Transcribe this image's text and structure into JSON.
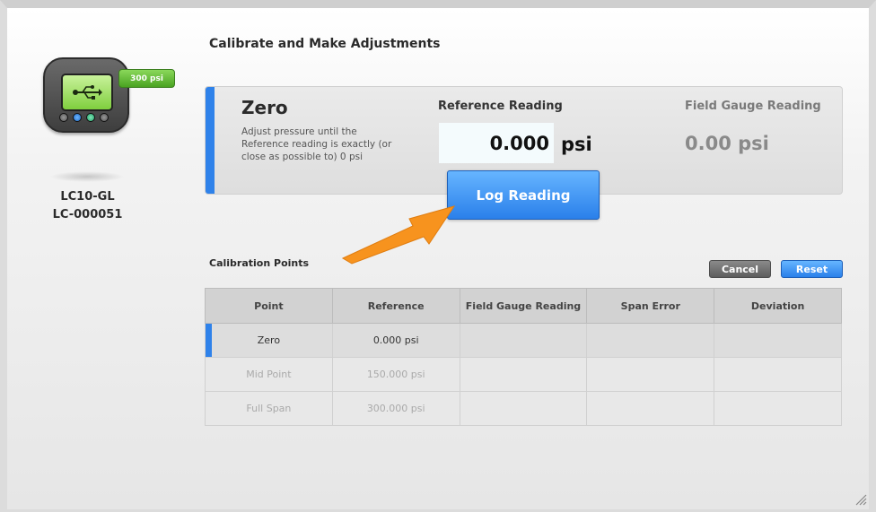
{
  "device": {
    "model": "LC10-GL",
    "serial": "LC-000051",
    "range_badge": "300 psi"
  },
  "page": {
    "title": "Calibrate and Make Adjustments"
  },
  "current_step": {
    "title": "Zero",
    "instruction": "Adjust pressure until the Reference reading is exactly (or close as possible to) 0 psi",
    "reference_label": "Reference Reading",
    "reference_value": "0.000",
    "reference_unit": "psi",
    "field_label": "Field Gauge Reading",
    "field_value": "0.00 psi",
    "log_button_label": "Log Reading"
  },
  "calibration_points": {
    "title": "Calibration Points",
    "cancel_label": "Cancel",
    "reset_label": "Reset",
    "columns": [
      "Point",
      "Reference",
      "Field Gauge Reading",
      "Span Error",
      "Deviation"
    ],
    "rows": [
      {
        "point": "Zero",
        "reference": "0.000 psi",
        "field": "",
        "span_error": "",
        "deviation": ""
      },
      {
        "point": "Mid Point",
        "reference": "150.000 psi",
        "field": "",
        "span_error": "",
        "deviation": ""
      },
      {
        "point": "Full Span",
        "reference": "300.000 psi",
        "field": "",
        "span_error": "",
        "deviation": ""
      }
    ]
  },
  "colors": {
    "accent": "#2f82ea",
    "badge": "#5cb832",
    "arrow": "#f7931e"
  }
}
